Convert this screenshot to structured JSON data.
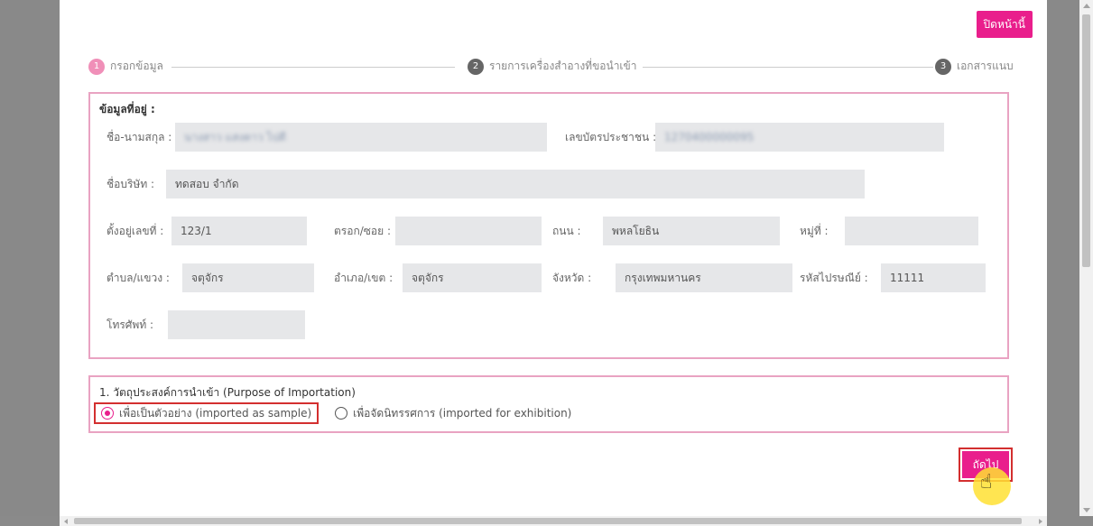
{
  "header": {
    "close_label": "ปิดหน้านี้"
  },
  "steps": [
    {
      "num": "1",
      "label": "กรอกข้อมูล"
    },
    {
      "num": "2",
      "label": "รายการเครื่องสำอางที่ขอนำเข้า"
    },
    {
      "num": "3",
      "label": "เอกสารแนบ"
    }
  ],
  "address": {
    "section_title": "ข้อมูลที่อยู่  :",
    "fullname": {
      "label": "ชื่อ-นามสกุล :",
      "value": "นางสาว แสงดาว ไปดี"
    },
    "id_card": {
      "label": "เลขบัตรประชาชน :",
      "value": "1270400000095"
    },
    "company": {
      "label": "ชื่อบริษัท :",
      "value": "ทดสอบ จำกัด"
    },
    "house_no": {
      "label": "ตั้งอยู่เลขที่ :",
      "value": "123/1"
    },
    "soi": {
      "label": "ตรอก/ซอย :",
      "value": ""
    },
    "road": {
      "label": "ถนน :",
      "value": "พหลโยธิน"
    },
    "moo": {
      "label": "หมู่ที่ :",
      "value": ""
    },
    "subdistrict": {
      "label": "ตำบล/แขวง :",
      "value": "จตุจักร"
    },
    "district": {
      "label": "อำเภอ/เขต :",
      "value": "จตุจักร"
    },
    "province": {
      "label": "จังหวัด :",
      "value": "กรุงเทพมหานคร"
    },
    "postcode": {
      "label": "รหัสไปรษณีย์ :",
      "value": "11111"
    },
    "phone": {
      "label": "โทรศัพท์ :",
      "value": ""
    }
  },
  "purpose": {
    "title": "1. วัตถุประสงค์การนำเข้า (Purpose of Importation)",
    "options": [
      {
        "label": "เพื่อเป็นตัวอย่าง (imported as sample)",
        "selected": true
      },
      {
        "label": "เพื่อจัดนิทรรศการ (imported for exhibition)",
        "selected": false
      }
    ]
  },
  "footer": {
    "next_label": "ถัดไป"
  },
  "colors": {
    "accent": "#e91e8c",
    "panel_border": "#e9a3c2",
    "highlight": "#d32f2f",
    "step_active": "#f08fb8"
  },
  "icons": {
    "cursor": "hand-pointer-icon"
  }
}
